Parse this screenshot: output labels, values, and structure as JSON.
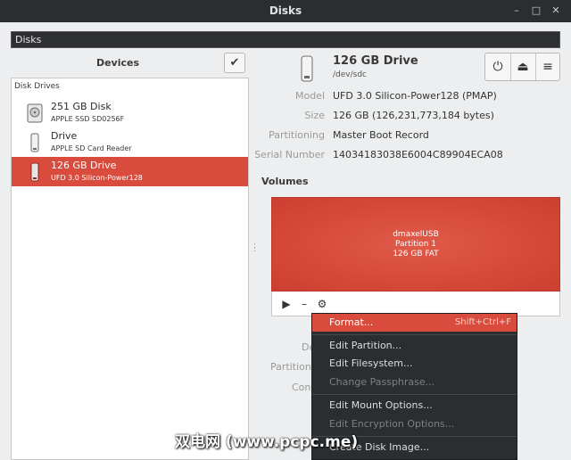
{
  "window": {
    "title": "Disks",
    "minimize_glyph": "–",
    "restore_glyph": "□",
    "close_glyph": "✕"
  },
  "header": {
    "label": "Disks"
  },
  "sidebar": {
    "title": "Devices",
    "check_icon": "✔",
    "section_label": "Disk Drives",
    "items": [
      {
        "name": "251 GB Disk",
        "sub": "APPLE SSD SD0256F",
        "icon": "hard-disk-icon"
      },
      {
        "name": "Drive",
        "sub": "APPLE SD Card Reader",
        "icon": "usb-drive-icon"
      },
      {
        "name": "126 GB Drive",
        "sub": "UFD 3.0 Silicon-Power128",
        "icon": "usb-drive-icon",
        "selected": true
      }
    ]
  },
  "drive": {
    "title": "126 GB Drive",
    "device": "/dev/sdc",
    "props": [
      {
        "label": "Model",
        "value": "UFD 3.0 Silicon-Power128 (PMAP)"
      },
      {
        "label": "Size",
        "value": "126 GB (126,231,773,184 bytes)"
      },
      {
        "label": "Partitioning",
        "value": "Master Boot Record"
      },
      {
        "label": "Serial Number",
        "value": "14034183038E6004C89904ECA08"
      }
    ],
    "toolbar": {
      "power_glyph": "⏻",
      "eject_glyph": "⏏",
      "menu_glyph": "≡"
    }
  },
  "volumes": {
    "title": "Volumes",
    "partition": {
      "line1": "dmaxelUSB",
      "line2": "Partition 1",
      "line3": "126 GB FAT"
    },
    "toolbar": {
      "play_glyph": "▶",
      "minus_glyph": "–",
      "gear_glyph": "⚙"
    },
    "behind_labels": [
      "De",
      "Partition T",
      "Cont"
    ]
  },
  "context_menu": {
    "items": [
      {
        "label": "Format...",
        "shortcut": "Shift+Ctrl+F",
        "active": true,
        "disabled": false
      },
      {
        "label": "Edit Partition...",
        "disabled": false
      },
      {
        "label": "Edit Filesystem...",
        "disabled": false
      },
      {
        "label": "Change Passphrase...",
        "disabled": true
      },
      {
        "label": "Edit Mount Options...",
        "disabled": false
      },
      {
        "label": "Edit Encryption Options...",
        "disabled": true
      },
      {
        "label": "Create Disk Image...",
        "disabled": false
      }
    ]
  },
  "watermark": {
    "text": "双电网 (www.pcpc.me)"
  },
  "colors": {
    "accent": "#d94b3c",
    "titlebar": "#2b2e31",
    "background": "#eceeef"
  }
}
